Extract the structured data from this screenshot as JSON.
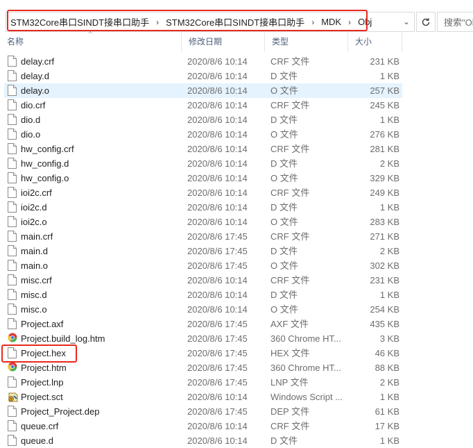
{
  "address": {
    "crumbs": [
      "STM32Core串口SINDT接串口助手",
      "STM32Core串口SINDT接串口助手",
      "MDK",
      "Obj"
    ],
    "search_placeholder": "搜索\"Ob"
  },
  "columns": {
    "name": "名称",
    "date": "修改日期",
    "type": "类型",
    "size": "大小"
  },
  "files": [
    {
      "name": "delay.crf",
      "date": "2020/8/6 10:14",
      "type": "CRF 文件",
      "size": "231 KB",
      "icon": "file"
    },
    {
      "name": "delay.d",
      "date": "2020/8/6 10:14",
      "type": "D 文件",
      "size": "1 KB",
      "icon": "file"
    },
    {
      "name": "delay.o",
      "date": "2020/8/6 10:14",
      "type": "O 文件",
      "size": "257 KB",
      "icon": "file",
      "selected": true
    },
    {
      "name": "dio.crf",
      "date": "2020/8/6 10:14",
      "type": "CRF 文件",
      "size": "245 KB",
      "icon": "file"
    },
    {
      "name": "dio.d",
      "date": "2020/8/6 10:14",
      "type": "D 文件",
      "size": "1 KB",
      "icon": "file"
    },
    {
      "name": "dio.o",
      "date": "2020/8/6 10:14",
      "type": "O 文件",
      "size": "276 KB",
      "icon": "file"
    },
    {
      "name": "hw_config.crf",
      "date": "2020/8/6 10:14",
      "type": "CRF 文件",
      "size": "281 KB",
      "icon": "file"
    },
    {
      "name": "hw_config.d",
      "date": "2020/8/6 10:14",
      "type": "D 文件",
      "size": "2 KB",
      "icon": "file"
    },
    {
      "name": "hw_config.o",
      "date": "2020/8/6 10:14",
      "type": "O 文件",
      "size": "329 KB",
      "icon": "file"
    },
    {
      "name": "ioi2c.crf",
      "date": "2020/8/6 10:14",
      "type": "CRF 文件",
      "size": "249 KB",
      "icon": "file"
    },
    {
      "name": "ioi2c.d",
      "date": "2020/8/6 10:14",
      "type": "D 文件",
      "size": "1 KB",
      "icon": "file"
    },
    {
      "name": "ioi2c.o",
      "date": "2020/8/6 10:14",
      "type": "O 文件",
      "size": "283 KB",
      "icon": "file"
    },
    {
      "name": "main.crf",
      "date": "2020/8/6 17:45",
      "type": "CRF 文件",
      "size": "271 KB",
      "icon": "file"
    },
    {
      "name": "main.d",
      "date": "2020/8/6 17:45",
      "type": "D 文件",
      "size": "2 KB",
      "icon": "file"
    },
    {
      "name": "main.o",
      "date": "2020/8/6 17:45",
      "type": "O 文件",
      "size": "302 KB",
      "icon": "file"
    },
    {
      "name": "misc.crf",
      "date": "2020/8/6 10:14",
      "type": "CRF 文件",
      "size": "231 KB",
      "icon": "file"
    },
    {
      "name": "misc.d",
      "date": "2020/8/6 10:14",
      "type": "D 文件",
      "size": "1 KB",
      "icon": "file"
    },
    {
      "name": "misc.o",
      "date": "2020/8/6 10:14",
      "type": "O 文件",
      "size": "254 KB",
      "icon": "file"
    },
    {
      "name": "Project.axf",
      "date": "2020/8/6 17:45",
      "type": "AXF 文件",
      "size": "435 KB",
      "icon": "file"
    },
    {
      "name": "Project.build_log.htm",
      "date": "2020/8/6 17:45",
      "type": "360 Chrome HT...",
      "size": "3 KB",
      "icon": "chrome"
    },
    {
      "name": "Project.hex",
      "date": "2020/8/6 17:45",
      "type": "HEX 文件",
      "size": "46 KB",
      "icon": "file"
    },
    {
      "name": "Project.htm",
      "date": "2020/8/6 17:45",
      "type": "360 Chrome HT...",
      "size": "88 KB",
      "icon": "chrome"
    },
    {
      "name": "Project.lnp",
      "date": "2020/8/6 17:45",
      "type": "LNP 文件",
      "size": "2 KB",
      "icon": "file"
    },
    {
      "name": "Project.sct",
      "date": "2020/8/6 10:14",
      "type": "Windows Script ...",
      "size": "1 KB",
      "icon": "script"
    },
    {
      "name": "Project_Project.dep",
      "date": "2020/8/6 17:45",
      "type": "DEP 文件",
      "size": "61 KB",
      "icon": "file"
    },
    {
      "name": "queue.crf",
      "date": "2020/8/6 10:14",
      "type": "CRF 文件",
      "size": "17 KB",
      "icon": "file"
    },
    {
      "name": "queue.d",
      "date": "2020/8/6 10:14",
      "type": "D 文件",
      "size": "1 KB",
      "icon": "file"
    }
  ],
  "colors": {
    "highlight": "#e8281e",
    "selection": "#e5f3ff",
    "header_text": "#4c607a"
  }
}
